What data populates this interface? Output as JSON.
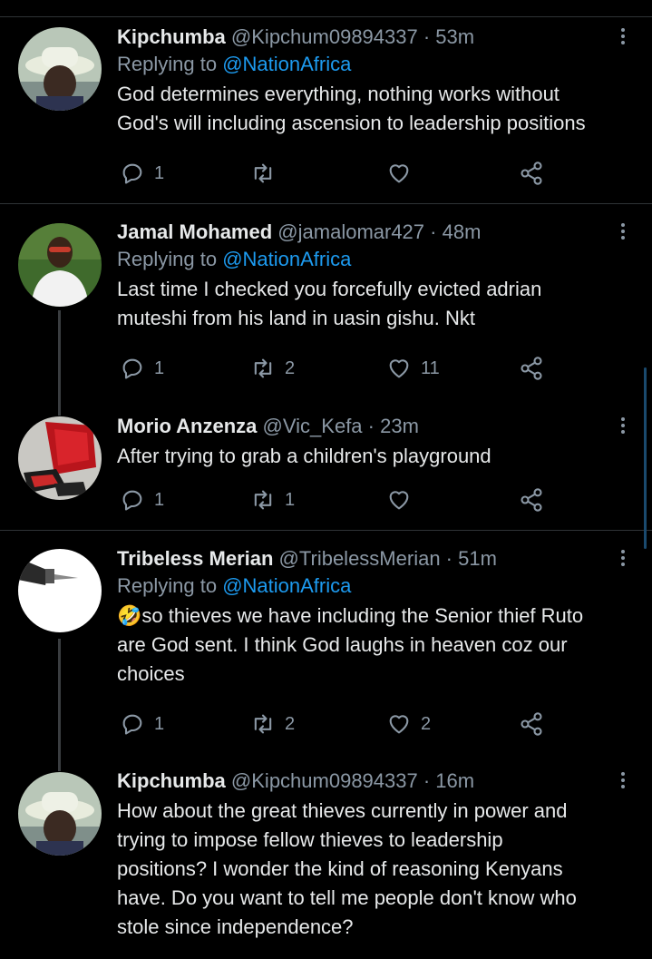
{
  "tweets": [
    {
      "name": "Kipchumba",
      "handle": "@Kipchum09894337",
      "time": "53m",
      "replying_prefix": "Replying to",
      "replying_to": "@NationAfrica",
      "lines": [
        "God determines everything, nothing works without",
        "God's will including ascension to leadership positions"
      ],
      "replies": "1",
      "retweets": "",
      "likes": ""
    },
    {
      "name": "Jamal Mohamed",
      "handle": "@jamalomar427",
      "time": "48m",
      "replying_prefix": "Replying to",
      "replying_to": "@NationAfrica",
      "lines": [
        "Last time I checked you forcefully evicted adrian",
        "muteshi from his land in uasin gishu. Nkt"
      ],
      "replies": "1",
      "retweets": "2",
      "likes": "11"
    },
    {
      "name": "Morio Anzenza",
      "handle": "@Vic_Kefa",
      "time": "23m",
      "lines": [
        "After trying to grab a children's playground"
      ],
      "replies": "1",
      "retweets": "1",
      "likes": ""
    },
    {
      "name": "Tribeless Merian",
      "handle": "@TribelessMerian",
      "time": "51m",
      "replying_prefix": "Replying to",
      "replying_to": "@NationAfrica",
      "lines": [
        "🤣so thieves we have including the Senior thief Ruto",
        "are God sent. I think God laughs in heaven coz our",
        "choices"
      ],
      "replies": "1",
      "retweets": "2",
      "likes": "2"
    },
    {
      "name": "Kipchumba",
      "handle": "@Kipchum09894337",
      "time": "16m",
      "lines": [
        "How about the great thieves currently in power and",
        "trying to impose fellow thieves to leadership",
        "positions? I wonder the kind of reasoning Kenyans",
        "have. Do you want to tell me people don't know who",
        "stole since independence?"
      ]
    }
  ],
  "icons": {
    "reply": "reply-icon",
    "retweet": "retweet-icon",
    "like": "heart-icon",
    "share": "share-icon",
    "more": "more-options-icon"
  },
  "colors": {
    "background": "#000000",
    "text": "#e7e9ea",
    "muted": "#8b98a5",
    "link": "#1d9bf0"
  }
}
